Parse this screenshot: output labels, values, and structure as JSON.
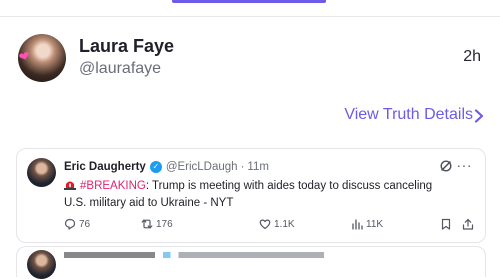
{
  "post": {
    "display_name": "Laura Faye",
    "handle": "@laurafaye",
    "timestamp": "2h",
    "view_details_label": "View Truth Details"
  },
  "embed": {
    "name": "Eric Daugherty",
    "handle": "@EricLDaugh",
    "separator": "·",
    "time": "11m",
    "more": "···",
    "breaking_tag": "#BREAKING",
    "body": ": Trump is meeting with aides today to discuss canceling U.S. military aid to Ukraine - NYT",
    "stats": {
      "replies": "76",
      "reposts": "176",
      "likes": "1.1K",
      "views": "11K"
    }
  },
  "colors": {
    "accent": "#6c5ce7",
    "verified": "#1d9bf0",
    "breaking": "#e0246f"
  },
  "icons": {
    "avatar_decoration": "pink-heart-icon",
    "verified": "verified-badge-icon",
    "grok": "grok-icon",
    "siren": "rotating-light-icon",
    "reply": "reply-icon",
    "repost": "repost-icon",
    "like": "heart-icon",
    "views": "views-chart-icon",
    "bookmark": "bookmark-icon",
    "share": "share-icon"
  }
}
